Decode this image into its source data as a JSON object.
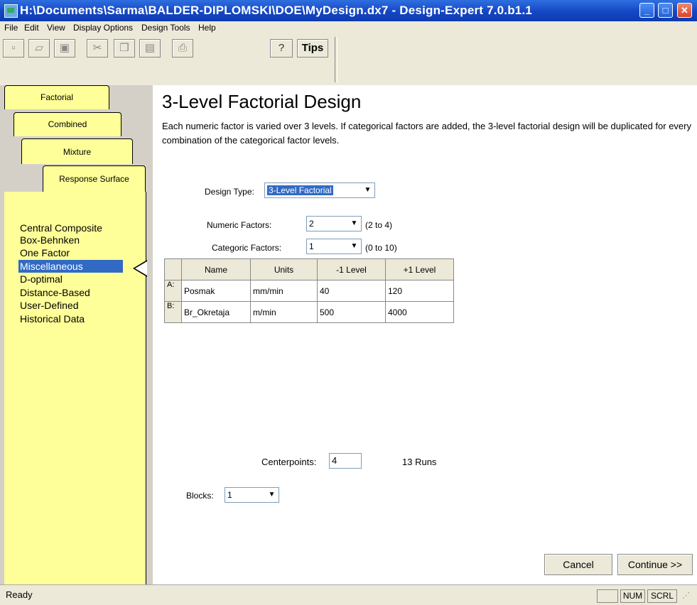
{
  "window": {
    "title": "H:\\Documents\\Sarma\\BALDER-DIPLOMSKI\\DOE\\MyDesign.dx7 - Design-Expert 7.0.b1.1"
  },
  "menu": [
    "File",
    "Edit",
    "View",
    "Display Options",
    "Design Tools",
    "Help"
  ],
  "toolbar": {
    "tips_label": "Tips"
  },
  "tabs": [
    "Factorial",
    "Combined",
    "Mixture",
    "Response Surface"
  ],
  "nav": {
    "items": [
      "Central Composite",
      "Box-Behnken",
      "One Factor",
      "Miscellaneous",
      "D-optimal",
      "Distance-Based",
      "User-Defined",
      "Historical Data"
    ],
    "selected": "Miscellaneous"
  },
  "design": {
    "title": "3-Level Factorial Design",
    "description": "Each numeric factor is varied over 3 levels.  If categorical factors are added, the 3-level factorial design will be duplicated for every combination of the categorical factor levels.",
    "type_label": "Design Type:",
    "type_value": "3-Level Factorial",
    "numeric_label": "Numeric Factors:",
    "numeric_value": "2",
    "numeric_range": "(2 to 4)",
    "categoric_label": "Categoric Factors:",
    "categoric_value": "1",
    "categoric_range": "(0 to 10)"
  },
  "factors": {
    "headers": [
      "Name",
      "Units",
      "-1 Level",
      "+1 Level"
    ],
    "rows": [
      {
        "id": "A:",
        "name": "Posmak",
        "units": "mm/min",
        "low": "40",
        "high": "120"
      },
      {
        "id": "B:",
        "name": "Br_Okretaja",
        "units": "m/min",
        "low": "500",
        "high": "4000"
      }
    ]
  },
  "centerpoints": {
    "label": "Centerpoints:",
    "value": "4",
    "runs": "13  Runs"
  },
  "blocks": {
    "label": "Blocks:",
    "value": "1"
  },
  "buttons": {
    "cancel": "Cancel",
    "continue": "Continue >>"
  },
  "status": {
    "text": "Ready",
    "num": "NUM",
    "scrl": "SCRL"
  },
  "colors": {
    "sidebar": "#ffff99",
    "selection": "#316ac5",
    "titlebar": "#1546c4"
  }
}
